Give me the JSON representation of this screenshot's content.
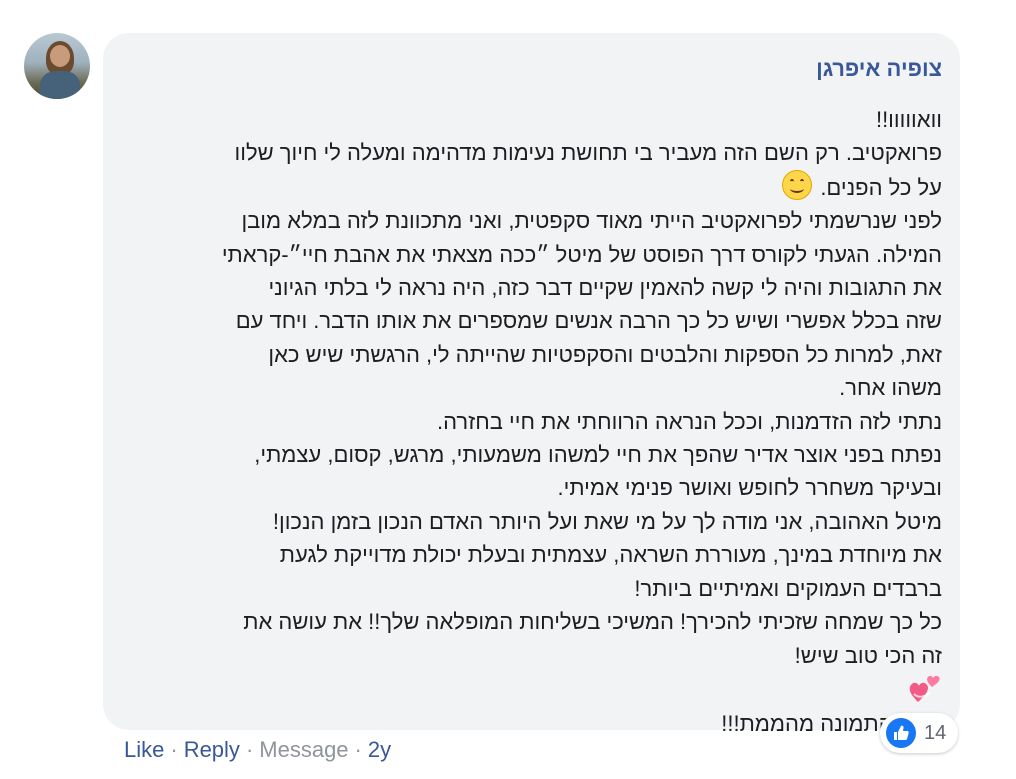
{
  "comment": {
    "author": "צופיה איפרגן",
    "lines": [
      "וואווווו!!",
      "פרואקטיב. רק השם הזה מעביר בי תחושת נעימות מדהימה ומעלה לי חיוך שלוו",
      "על כל הפנים.",
      "לפני שנרשמתי לפרואקטיב הייתי מאוד סקפטית, ואני מתכוונת לזה במלא מובן",
      "המילה. הגעתי לקורס דרך הפוסט של מיטל ״ככה מצאתי את אהבת חיי״-קראתי",
      "את התגובות והיה לי קשה להאמין שקיים דבר כזה, היה נראה לי בלתי הגיוני",
      "שזה בכלל אפשרי ושיש כל כך הרבה אנשים שמספרים את אותו הדבר. ויחד עם",
      "זאת, למרות כל הספקות והלבטים והסקפטיות שהייתה לי, הרגשתי שיש כאן",
      "משהו אחר.",
      "נתתי לזה הזדמנות, וככל הנראה הרווחתי את חיי בחזרה.",
      "נפתח בפני אוצר אדיר שהפך את חיי למשהו משמעותי, מרגש, קסום, עצמתי,",
      "ובעיקר משחרר לחופש ואושר פנימי אמיתי.",
      "מיטל האהובה, אני מודה לך על מי שאת ועל היותר האדם הנכון בזמן הנכון!",
      "את מיוחדת במינך, מעוררת השראה, עצמתית ובעלת יכולת מדוייקת לגעת",
      "ברבדים העמוקים ואמיתיים ביותר!",
      "כל כך שמחה שזכיתי להכירך! המשיכי בשליחות המופלאה שלך!! את עושה את",
      "זה הכי טוב שיש!",
      "",
      "ואגב-התמונה מהממת!!!"
    ],
    "smile_emoji": "smiling-face-emoji",
    "hearts_emoji": "two-hearts-emoji"
  },
  "actions": {
    "like": "Like",
    "reply": "Reply",
    "message": "Message",
    "time": "2y",
    "separator": "·"
  },
  "reactions": {
    "icon": "like-thumb-icon",
    "count": "14"
  },
  "colors": {
    "bubble": "#f2f3f5",
    "link": "#385898",
    "muted": "#90949c",
    "like_blue": "#1877f2"
  }
}
